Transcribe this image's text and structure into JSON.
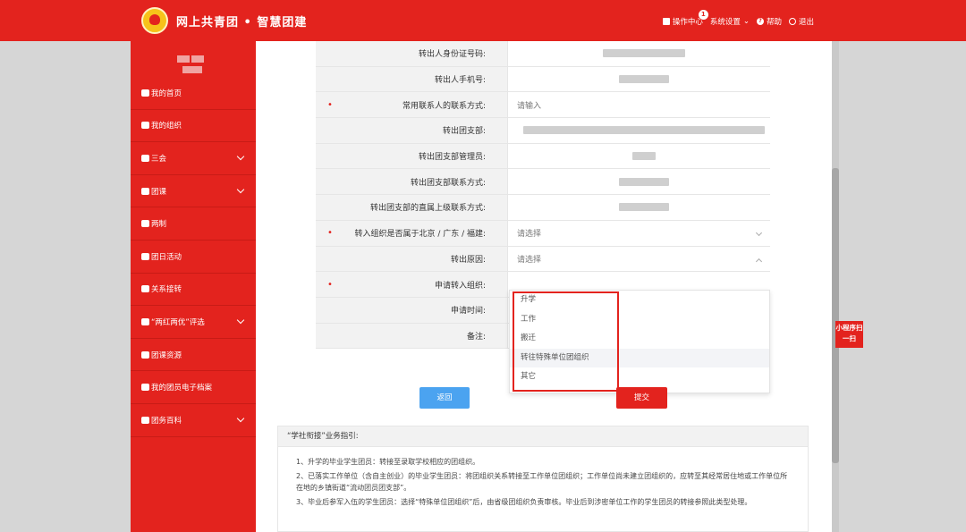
{
  "header": {
    "brand": "网上共青团 • 智慧团建",
    "nav": [
      {
        "label": "操作中心",
        "icon": "mail-icon",
        "badge": "1"
      },
      {
        "label": "系统设置",
        "icon": "chevron-down-icon"
      },
      {
        "label": "帮助",
        "icon": "help-icon"
      },
      {
        "label": "退出",
        "icon": "power-icon"
      }
    ]
  },
  "sidebar": {
    "items": [
      {
        "label": "我的首页",
        "icon": "home-icon",
        "expandable": false
      },
      {
        "label": "我的组织",
        "icon": "group-icon",
        "expandable": false
      },
      {
        "label": "三会",
        "icon": "edit-icon",
        "expandable": true
      },
      {
        "label": "团课",
        "icon": "folder-icon",
        "expandable": true
      },
      {
        "label": "两制",
        "icon": "circle-icon",
        "expandable": false
      },
      {
        "label": "团日活动",
        "icon": "recycle-icon",
        "expandable": false
      },
      {
        "label": "关系接转",
        "icon": "refresh-icon",
        "expandable": false
      },
      {
        "label": "“两红两优”评选",
        "icon": "edit-icon",
        "expandable": true
      },
      {
        "label": "团课资源",
        "icon": "folder-icon",
        "expandable": false
      },
      {
        "label": "我的团员电子档案",
        "icon": "document-icon",
        "expandable": false
      },
      {
        "label": "团务百科",
        "icon": "group-icon",
        "expandable": true
      }
    ]
  },
  "form": {
    "rows": [
      {
        "label": "转出人身份证号码:",
        "required": false,
        "type": "blur",
        "blur_width": 92
      },
      {
        "label": "转出人手机号:",
        "required": false,
        "type": "blur",
        "blur_width": 56
      },
      {
        "label": "常用联系人的联系方式:",
        "required": true,
        "type": "input",
        "placeholder": "请输入"
      },
      {
        "label": "转出团支部:",
        "required": false,
        "type": "blur",
        "blur_width": 270
      },
      {
        "label": "转出团支部管理员:",
        "required": false,
        "type": "blur",
        "blur_width": 26
      },
      {
        "label": "转出团支部联系方式:",
        "required": false,
        "type": "blur",
        "blur_width": 56
      },
      {
        "label": "转出团支部的直属上级联系方式:",
        "required": false,
        "type": "blur",
        "blur_width": 56
      },
      {
        "label": "转入组织是否属于北京 / 广东 / 福建:",
        "required": true,
        "type": "select",
        "placeholder": "请选择",
        "state": "closed"
      },
      {
        "label": "转出原因:",
        "required": false,
        "type": "select",
        "placeholder": "请选择",
        "state": "open"
      },
      {
        "label": "申请转入组织:",
        "required": true,
        "type": "empty"
      },
      {
        "label": "申请时间:",
        "required": false,
        "type": "empty"
      },
      {
        "label": "备注:",
        "required": false,
        "type": "empty"
      }
    ],
    "dropdown_options": [
      "升学",
      "工作",
      "搬迁",
      "转往特殊单位团组织",
      "其它"
    ],
    "hovered_option": "转往特殊单位团组织",
    "back_label": "返回",
    "submit_label": "提交"
  },
  "guide": {
    "title": "“学社衔接”业务指引:",
    "items": [
      "1、升学的毕业学生团员：转接至录取学校相应的团组织。",
      "2、已落实工作单位（含自主创业）的毕业学生团员：将团组织关系转接至工作单位团组织；工作单位尚未建立团组织的，应转至其经常居住地或工作单位所在地的乡镇街道“流动团员团支部”。",
      "3、毕业后参军入伍的学生团员：选择“特殊单位团组织”后，由省级团组织负责审核。毕业后到涉密单位工作的学生团员的转接参照此类型处理。"
    ]
  },
  "mini_program": {
    "label": "小程序扫一扫"
  },
  "colors": {
    "primary": "#e3231e",
    "button_blue": "#4ba3f0"
  }
}
